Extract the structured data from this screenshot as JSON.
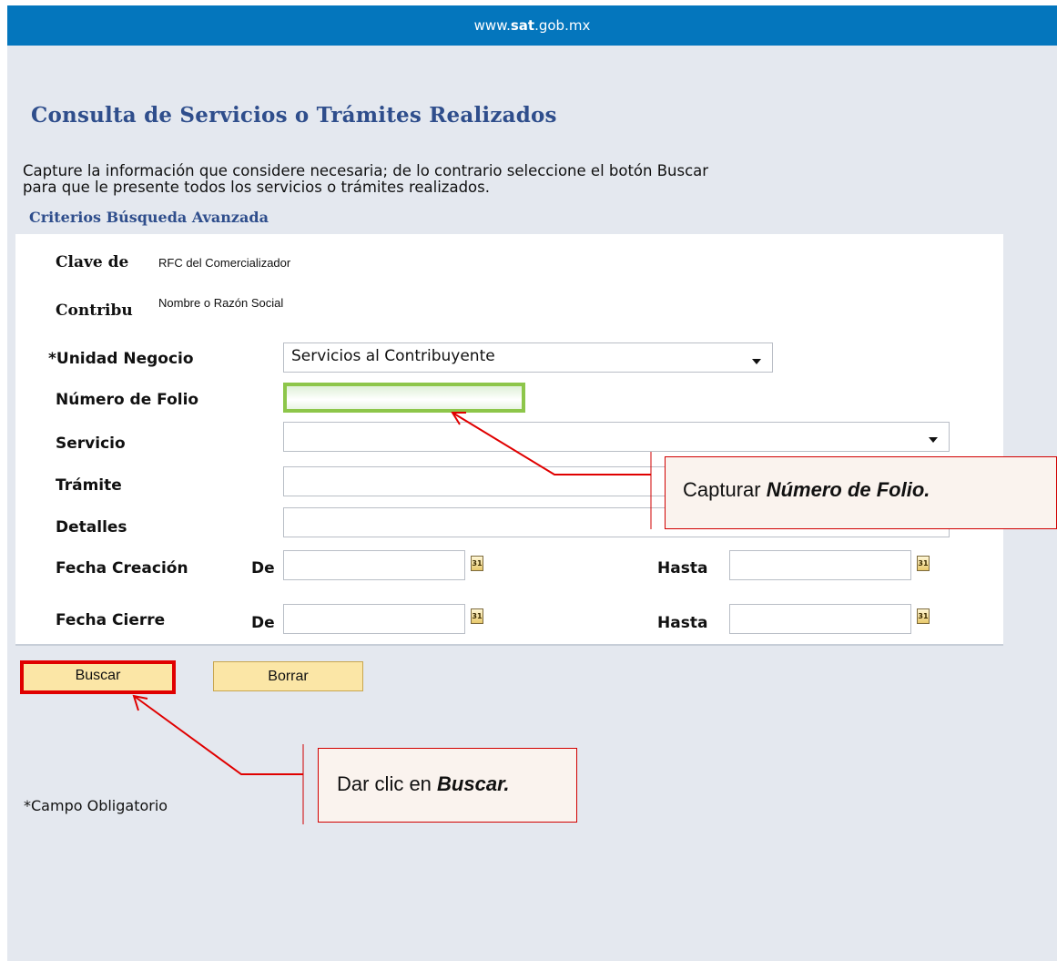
{
  "header": {
    "site_prefix": "www.",
    "site_bold": "sat",
    "site_suffix": ".gob.mx"
  },
  "page": {
    "title": "Consulta de Servicios o Trámites Realizados",
    "instructions_line1": "Capture la información que considere necesaria; de lo contrario seleccione el botón Buscar",
    "instructions_line2": "para que le presente todos los servicios o trámites realizados.",
    "advanced_heading": "Criterios Búsqueda Avanzada"
  },
  "form": {
    "clave_label": "Clave de",
    "clave_value": "RFC del Comercializador",
    "contrib_label": "Contribu",
    "contrib_value": "Nombre o Razón Social",
    "unidad_label": "*Unidad Negocio",
    "unidad_value": "Servicios al Contribuyente",
    "folio_label": "Número de Folio",
    "folio_value": "",
    "servicio_label": "Servicio",
    "servicio_value": "",
    "tramite_label": "Trámite",
    "tramite_value": "",
    "detalles_label": "Detalles",
    "detalles_value": "",
    "fecha_creacion_label": "Fecha Creación",
    "fecha_cierre_label": "Fecha Cierre",
    "de_label": "De",
    "hasta_label": "Hasta",
    "calendar_glyph": "31"
  },
  "buttons": {
    "buscar": "Buscar",
    "borrar": "Borrar"
  },
  "footer": {
    "required_note": "*Campo Obligatorio"
  },
  "callouts": {
    "folio_prefix": "Capturar ",
    "folio_emph": "Número de Folio.",
    "buscar_prefix": "Dar clic en ",
    "buscar_emph": "Buscar."
  },
  "icons": [
    "calendar-icon",
    "chevron-down-icon"
  ],
  "colors": {
    "header_blue": "#0476bd",
    "title_blue": "#2f4e8c",
    "highlight_red": "#e00000",
    "folio_green": "#8dc64a",
    "button_fill": "#fbe6a6"
  }
}
